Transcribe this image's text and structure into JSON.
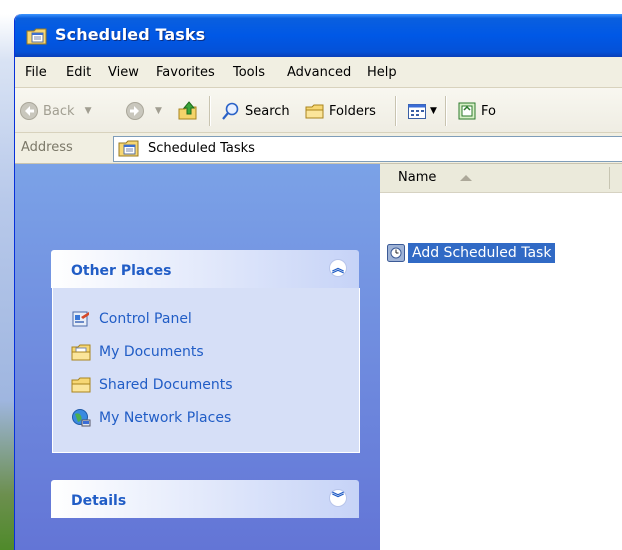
{
  "window": {
    "title": "Scheduled Tasks"
  },
  "menu": [
    "File",
    "Edit",
    "View",
    "Favorites",
    "Tools",
    "Advanced",
    "Help"
  ],
  "toolbar": {
    "back_label": "Back",
    "search_label": "Search",
    "folders_label": "Folders",
    "partial_label": "Fo"
  },
  "address": {
    "label": "Address",
    "value": "Scheduled Tasks"
  },
  "task_pane": {
    "other_places": {
      "title": "Other Places",
      "items": [
        {
          "label": "Control Panel",
          "icon": "control-panel-icon"
        },
        {
          "label": "My Documents",
          "icon": "my-documents-icon"
        },
        {
          "label": "Shared Documents",
          "icon": "shared-documents-icon"
        },
        {
          "label": "My Network Places",
          "icon": "network-places-icon"
        }
      ]
    },
    "details": {
      "title": "Details"
    }
  },
  "content": {
    "column_header": "Name",
    "items": [
      {
        "name": "Add Scheduled Task",
        "selected": true
      }
    ]
  },
  "colors": {
    "titlebar": "#0058e6",
    "taskpane": "#7ba2e7",
    "link": "#215dc6",
    "selection": "#316ac5"
  }
}
